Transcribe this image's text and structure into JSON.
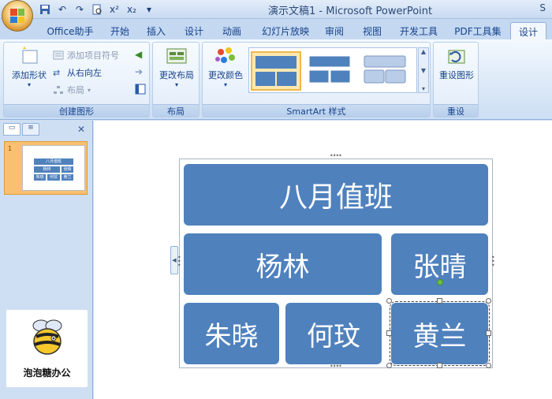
{
  "window": {
    "title": "演示文稿1 - Microsoft PowerPoint",
    "title_right": "S"
  },
  "quick_access": [
    "save-icon",
    "undo-icon",
    "redo-icon",
    "print-preview-icon",
    "superscript-icon",
    "subscript-icon",
    "customize-icon"
  ],
  "tabs": [
    {
      "label": "Office助手",
      "active": false
    },
    {
      "label": "开始",
      "active": false
    },
    {
      "label": "插入",
      "active": false
    },
    {
      "label": "设计",
      "active": false
    },
    {
      "label": "动画",
      "active": false
    },
    {
      "label": "幻灯片放映",
      "active": false
    },
    {
      "label": "审阅",
      "active": false
    },
    {
      "label": "视图",
      "active": false
    },
    {
      "label": "开发工具",
      "active": false
    },
    {
      "label": "PDF工具集",
      "active": false
    },
    {
      "label": "设计",
      "active": true
    }
  ],
  "ribbon": {
    "create_graphic": {
      "label": "创建图形",
      "add_shape": "添加形状",
      "add_bullet": "添加项目符号",
      "right_to_left": "从右向左",
      "layout": "布局"
    },
    "layouts": {
      "label": "布局",
      "change_layout": "更改布局"
    },
    "smartart_styles": {
      "label": "SmartArt 样式",
      "change_colors": "更改颜色"
    },
    "reset": {
      "label": "重设",
      "reset_graphic": "重设图形"
    }
  },
  "left_panel": {
    "slide_number": "1",
    "logo_text": "泡泡糖办公"
  },
  "smartart": {
    "title": "八月值班",
    "row2": [
      "杨林",
      "张晴"
    ],
    "row3": [
      "朱晓",
      "何玟",
      "黄兰"
    ]
  },
  "colors": {
    "shape_fill": "#4f81bd",
    "ribbon_bg": "#dbe8f7",
    "selected_thumb": "#f8c070"
  }
}
